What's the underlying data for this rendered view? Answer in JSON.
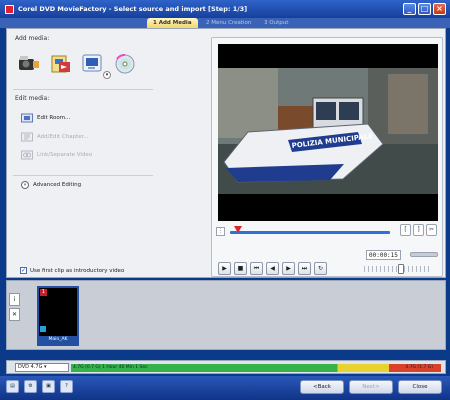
{
  "window": {
    "title": "Corel DVD MovieFactory - Select source and import [Step: 1/3]",
    "controls": [
      "_",
      "□",
      "×"
    ]
  },
  "steps": [
    {
      "label": "1 Add Media"
    },
    {
      "label": "2 Menu Creation"
    },
    {
      "label": "3 Output"
    }
  ],
  "left_panel": {
    "add_media_label": "Add media:",
    "edit_media_label": "Edit media:",
    "edit_items": [
      {
        "label": "Edit Room..."
      },
      {
        "label": "Add/Edit Chapter..."
      },
      {
        "label": "Link/Separate Video"
      }
    ],
    "advanced_label": "Advanced Editing"
  },
  "player": {
    "timecode": "00:00:15",
    "video_text": "POLIZIA MUNICIPALE",
    "position_fraction": 0.05
  },
  "first_clip_label": "Use first clip as introductory video",
  "clip_strip": {
    "clips": [
      {
        "badge": "1",
        "caption": "Main_AK"
      }
    ]
  },
  "capacity": {
    "format": "DVD 4.7G",
    "left_text": "4.7G (0.7 G) 1 Hour 46 Min 1 Sec",
    "right_text": "4.7G (1.7 G)",
    "used_fraction": 0.72
  },
  "bottom": {
    "back_label": "<Back",
    "next_label": "Next>",
    "close_label": "Close"
  }
}
